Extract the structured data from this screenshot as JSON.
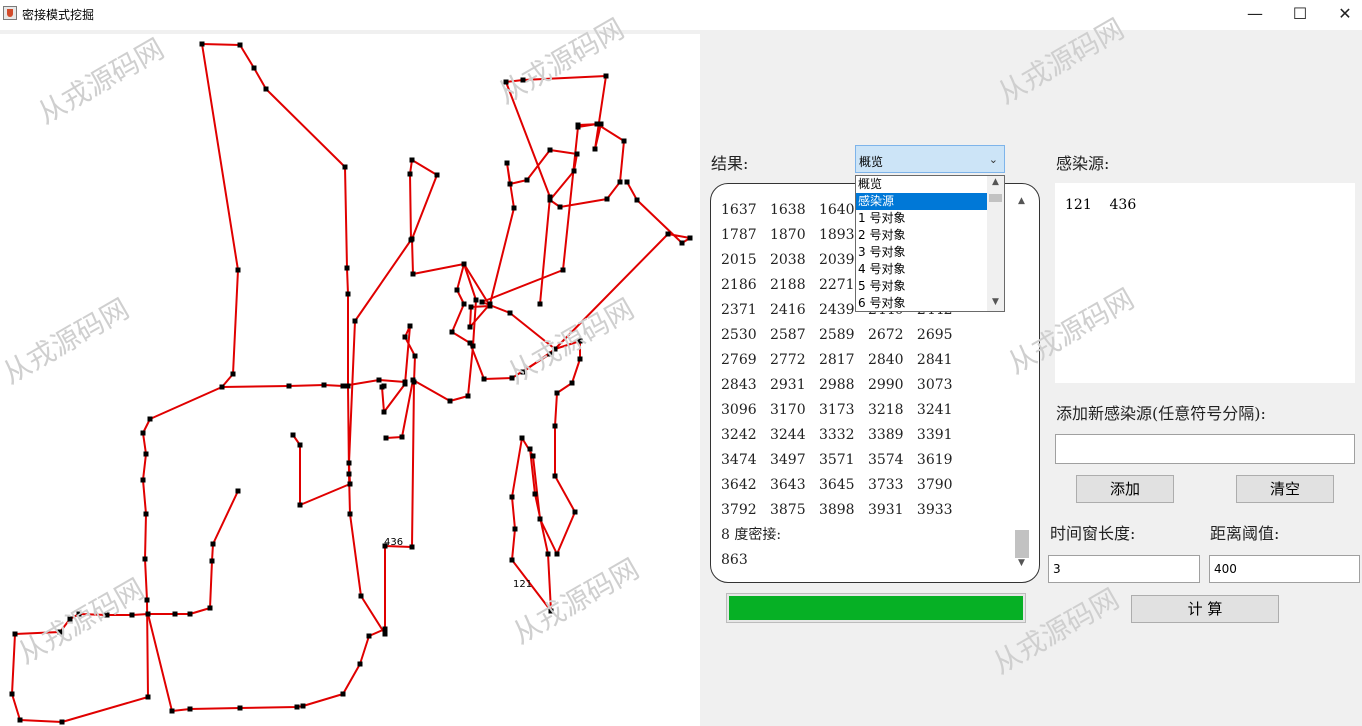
{
  "window": {
    "title": "密接模式挖掘",
    "minimize_icon": "minimize-icon",
    "maximize_icon": "maximize-icon",
    "close_icon": "close-icon"
  },
  "canvas": {
    "labels": [
      "436",
      "121"
    ],
    "line_color": "#e00000",
    "point_color": "#000000"
  },
  "results": {
    "label": "结果:",
    "select_value": "概览",
    "options": [
      "概览",
      "感染源",
      "1 号对象",
      "2 号对象",
      "3 号对象",
      "4 号对象",
      "5 号对象",
      "6 号对象"
    ],
    "selected_option": "感染源",
    "rows": [
      [
        "1637",
        "1638",
        "1640",
        "",
        ""
      ],
      [
        "1787",
        "1870",
        "1893",
        "",
        ""
      ],
      [
        "2015",
        "2038",
        "2039",
        "",
        ""
      ],
      [
        "2186",
        "2188",
        "2271",
        "",
        ""
      ],
      [
        "2371",
        "2416",
        "2439",
        "2440",
        "2442"
      ],
      [
        "2530",
        "2587",
        "2589",
        "2672",
        "2695"
      ],
      [
        "2769",
        "2772",
        "2817",
        "2840",
        "2841"
      ],
      [
        "2843",
        "2931",
        "2988",
        "2990",
        "3073"
      ],
      [
        "3096",
        "3170",
        "3173",
        "3218",
        "3241"
      ],
      [
        "3242",
        "3244",
        "3332",
        "3389",
        "3391"
      ],
      [
        "3474",
        "3497",
        "3571",
        "3574",
        "3619"
      ],
      [
        "3642",
        "3643",
        "3645",
        "3733",
        "3790"
      ],
      [
        "3792",
        "3875",
        "3898",
        "3931",
        "3933"
      ]
    ],
    "degree_heading": "8 度密接:",
    "degree_values": "863"
  },
  "infection": {
    "label": "感染源:",
    "sources": "121    436",
    "add_label": "添加新感染源(任意符号分隔):",
    "add_input_value": "",
    "add_button": "添加",
    "clear_button": "清空"
  },
  "params": {
    "time_window_label": "时间窗长度:",
    "time_window_value": "3",
    "distance_label": "距离阈值:",
    "distance_value": "400",
    "compute_button": "计 算"
  },
  "progress": {
    "value": 1.0,
    "color": "#06b025"
  },
  "watermark": "从戎源码网"
}
